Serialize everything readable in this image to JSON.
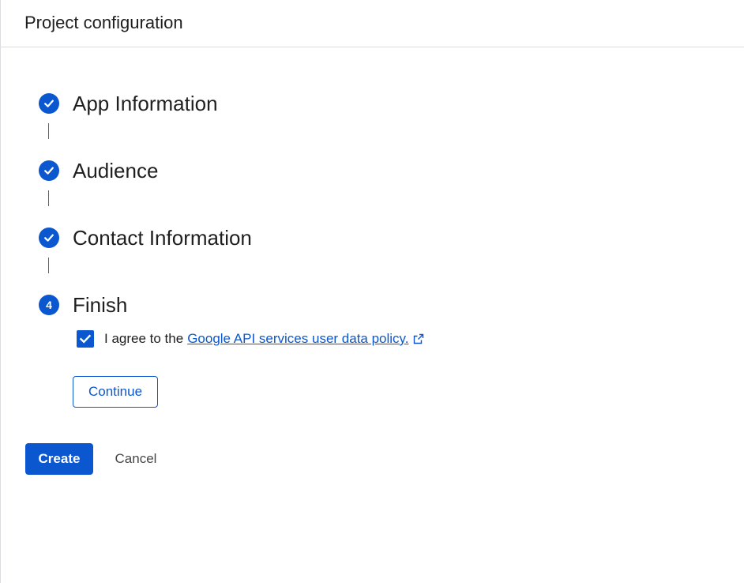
{
  "header": {
    "title": "Project configuration"
  },
  "steps": [
    {
      "label": "App Information",
      "status": "complete",
      "icon": "check-icon"
    },
    {
      "label": "Audience",
      "status": "complete",
      "icon": "check-icon"
    },
    {
      "label": "Contact Information",
      "status": "complete",
      "icon": "check-icon"
    },
    {
      "label": "Finish",
      "status": "active",
      "number": "4"
    }
  ],
  "finish": {
    "agree_text": "I agree to the",
    "agree_link": "Google API services user data policy.",
    "agree_checked": true,
    "continue_label": "Continue"
  },
  "actions": {
    "create_label": "Create",
    "cancel_label": "Cancel"
  },
  "colors": {
    "accent": "#0b57d0",
    "text": "#1f1f1f",
    "divider": "#dadce0"
  }
}
